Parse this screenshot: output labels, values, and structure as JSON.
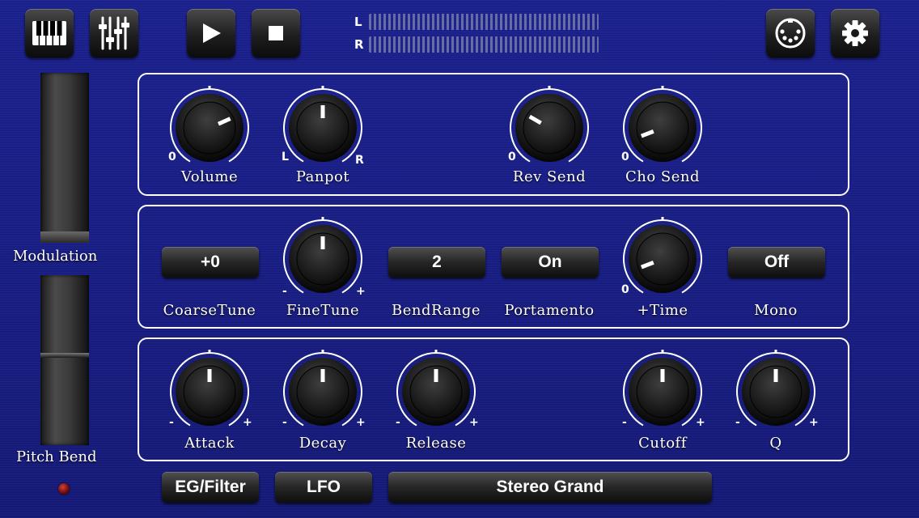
{
  "toolbar": {
    "piano_icon": "piano-keys-icon",
    "mixer_icon": "mixer-sliders-icon",
    "play_icon": "play-icon",
    "stop_icon": "stop-icon",
    "midi_icon": "midi-connector-icon",
    "settings_icon": "gear-icon"
  },
  "meter": {
    "left_label": "L",
    "right_label": "R"
  },
  "wheels": {
    "modulation_label": "Modulation",
    "pitch_bend_label": "Pitch Bend"
  },
  "panel1": {
    "volume": {
      "label": "Volume",
      "min_label": "0",
      "value": 0.72
    },
    "panpot": {
      "label": "Panpot",
      "min_label": "L",
      "max_label": "R",
      "value": 0.5
    },
    "rev_send": {
      "label": "Rev Send",
      "min_label": "0",
      "value": 0.3
    },
    "cho_send": {
      "label": "Cho Send",
      "min_label": "0",
      "value": 0.13
    }
  },
  "panel2": {
    "coarse_tune": {
      "label": "CoarseTune",
      "value": "+0"
    },
    "fine_tune": {
      "label": "FineTune",
      "min_label": "-",
      "max_label": "+",
      "value": 0.5
    },
    "bend_range": {
      "label": "BendRange",
      "value": "2"
    },
    "portamento": {
      "label": "Portamento",
      "value": "On"
    },
    "time": {
      "label": "+Time",
      "min_label": "0",
      "value": 0.13
    },
    "mono": {
      "label": "Mono",
      "value": "Off"
    }
  },
  "panel3": {
    "attack": {
      "label": "Attack",
      "min_label": "-",
      "max_label": "+",
      "value": 0.5
    },
    "decay": {
      "label": "Decay",
      "min_label": "-",
      "max_label": "+",
      "value": 0.5
    },
    "release": {
      "label": "Release",
      "min_label": "-",
      "max_label": "+",
      "value": 0.5
    },
    "cutoff": {
      "label": "Cutoff",
      "min_label": "-",
      "max_label": "+",
      "value": 0.5
    },
    "q": {
      "label": "Q",
      "min_label": "-",
      "max_label": "+",
      "value": 0.5
    }
  },
  "bottom": {
    "eg_filter_label": "EG/Filter",
    "lfo_label": "LFO",
    "preset_name": "Stereo Grand"
  },
  "colors": {
    "background": "#1a1f88",
    "panel_border": "#ffffff",
    "led": "#a01818"
  }
}
